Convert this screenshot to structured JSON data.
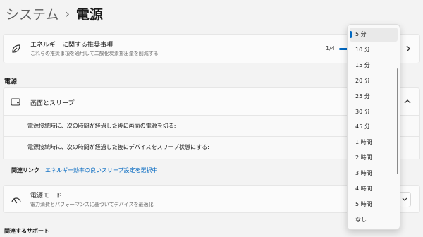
{
  "breadcrumb": {
    "parent": "システム",
    "separator": "›",
    "current": "電源"
  },
  "recommendation": {
    "title": "エネルギーに関する推奨事項",
    "description": "これらの推奨事項を適用して二酸化炭素排出量を削減する",
    "count": "1/4",
    "progress": 0.25
  },
  "power_section": {
    "title": "電源"
  },
  "screen_sleep": {
    "label": "画面とスリープ",
    "rows": [
      {
        "label": "電源接続時に、次の時間が経過した後に画面の電源を切る:"
      },
      {
        "label": "電源接続時に、次の時間が経過した後にデバイスをスリープ状態にする:"
      }
    ]
  },
  "related_links": {
    "heading": "関連リンク",
    "link": "エネルギー効率の良いスリープ設定を選択中"
  },
  "power_mode": {
    "title": "電源モード",
    "description": "電力消費とパフォーマンスに基づいてデバイスを最適化"
  },
  "support": {
    "heading": "関連するサポート"
  },
  "dropdown": {
    "selected_index": 0,
    "options": [
      "5 分",
      "10 分",
      "15 分",
      "20 分",
      "25 分",
      "30 分",
      "45 分",
      "1 時間",
      "2 時間",
      "3 時間",
      "4 時間",
      "5 時間",
      "なし"
    ]
  },
  "colors": {
    "accent": "#0067c0",
    "background": "#f3f3f3",
    "card": "#fbfbfb"
  },
  "icons": [
    "leaf-icon",
    "monitor-sleep-icon",
    "power-mode-icon",
    "chevron-right-icon",
    "chevron-up-icon",
    "chevron-down-icon"
  ]
}
